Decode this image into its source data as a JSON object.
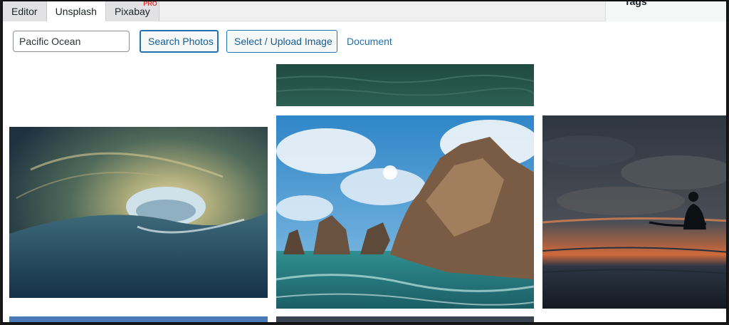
{
  "tabs": [
    {
      "label": "Editor",
      "active": false
    },
    {
      "label": "Unsplash",
      "active": true
    },
    {
      "label": "Pixabay",
      "active": false,
      "badge": "PRO"
    }
  ],
  "sidebar": {
    "tags_label": "Tags"
  },
  "search": {
    "value": "Pacific Ocean"
  },
  "toolbar": {
    "search_button": "Search Photos",
    "upload_button": "Select / Upload Image",
    "document_link": "Document"
  },
  "colors": {
    "accent": "#2271b1",
    "badge": "#d63638"
  }
}
